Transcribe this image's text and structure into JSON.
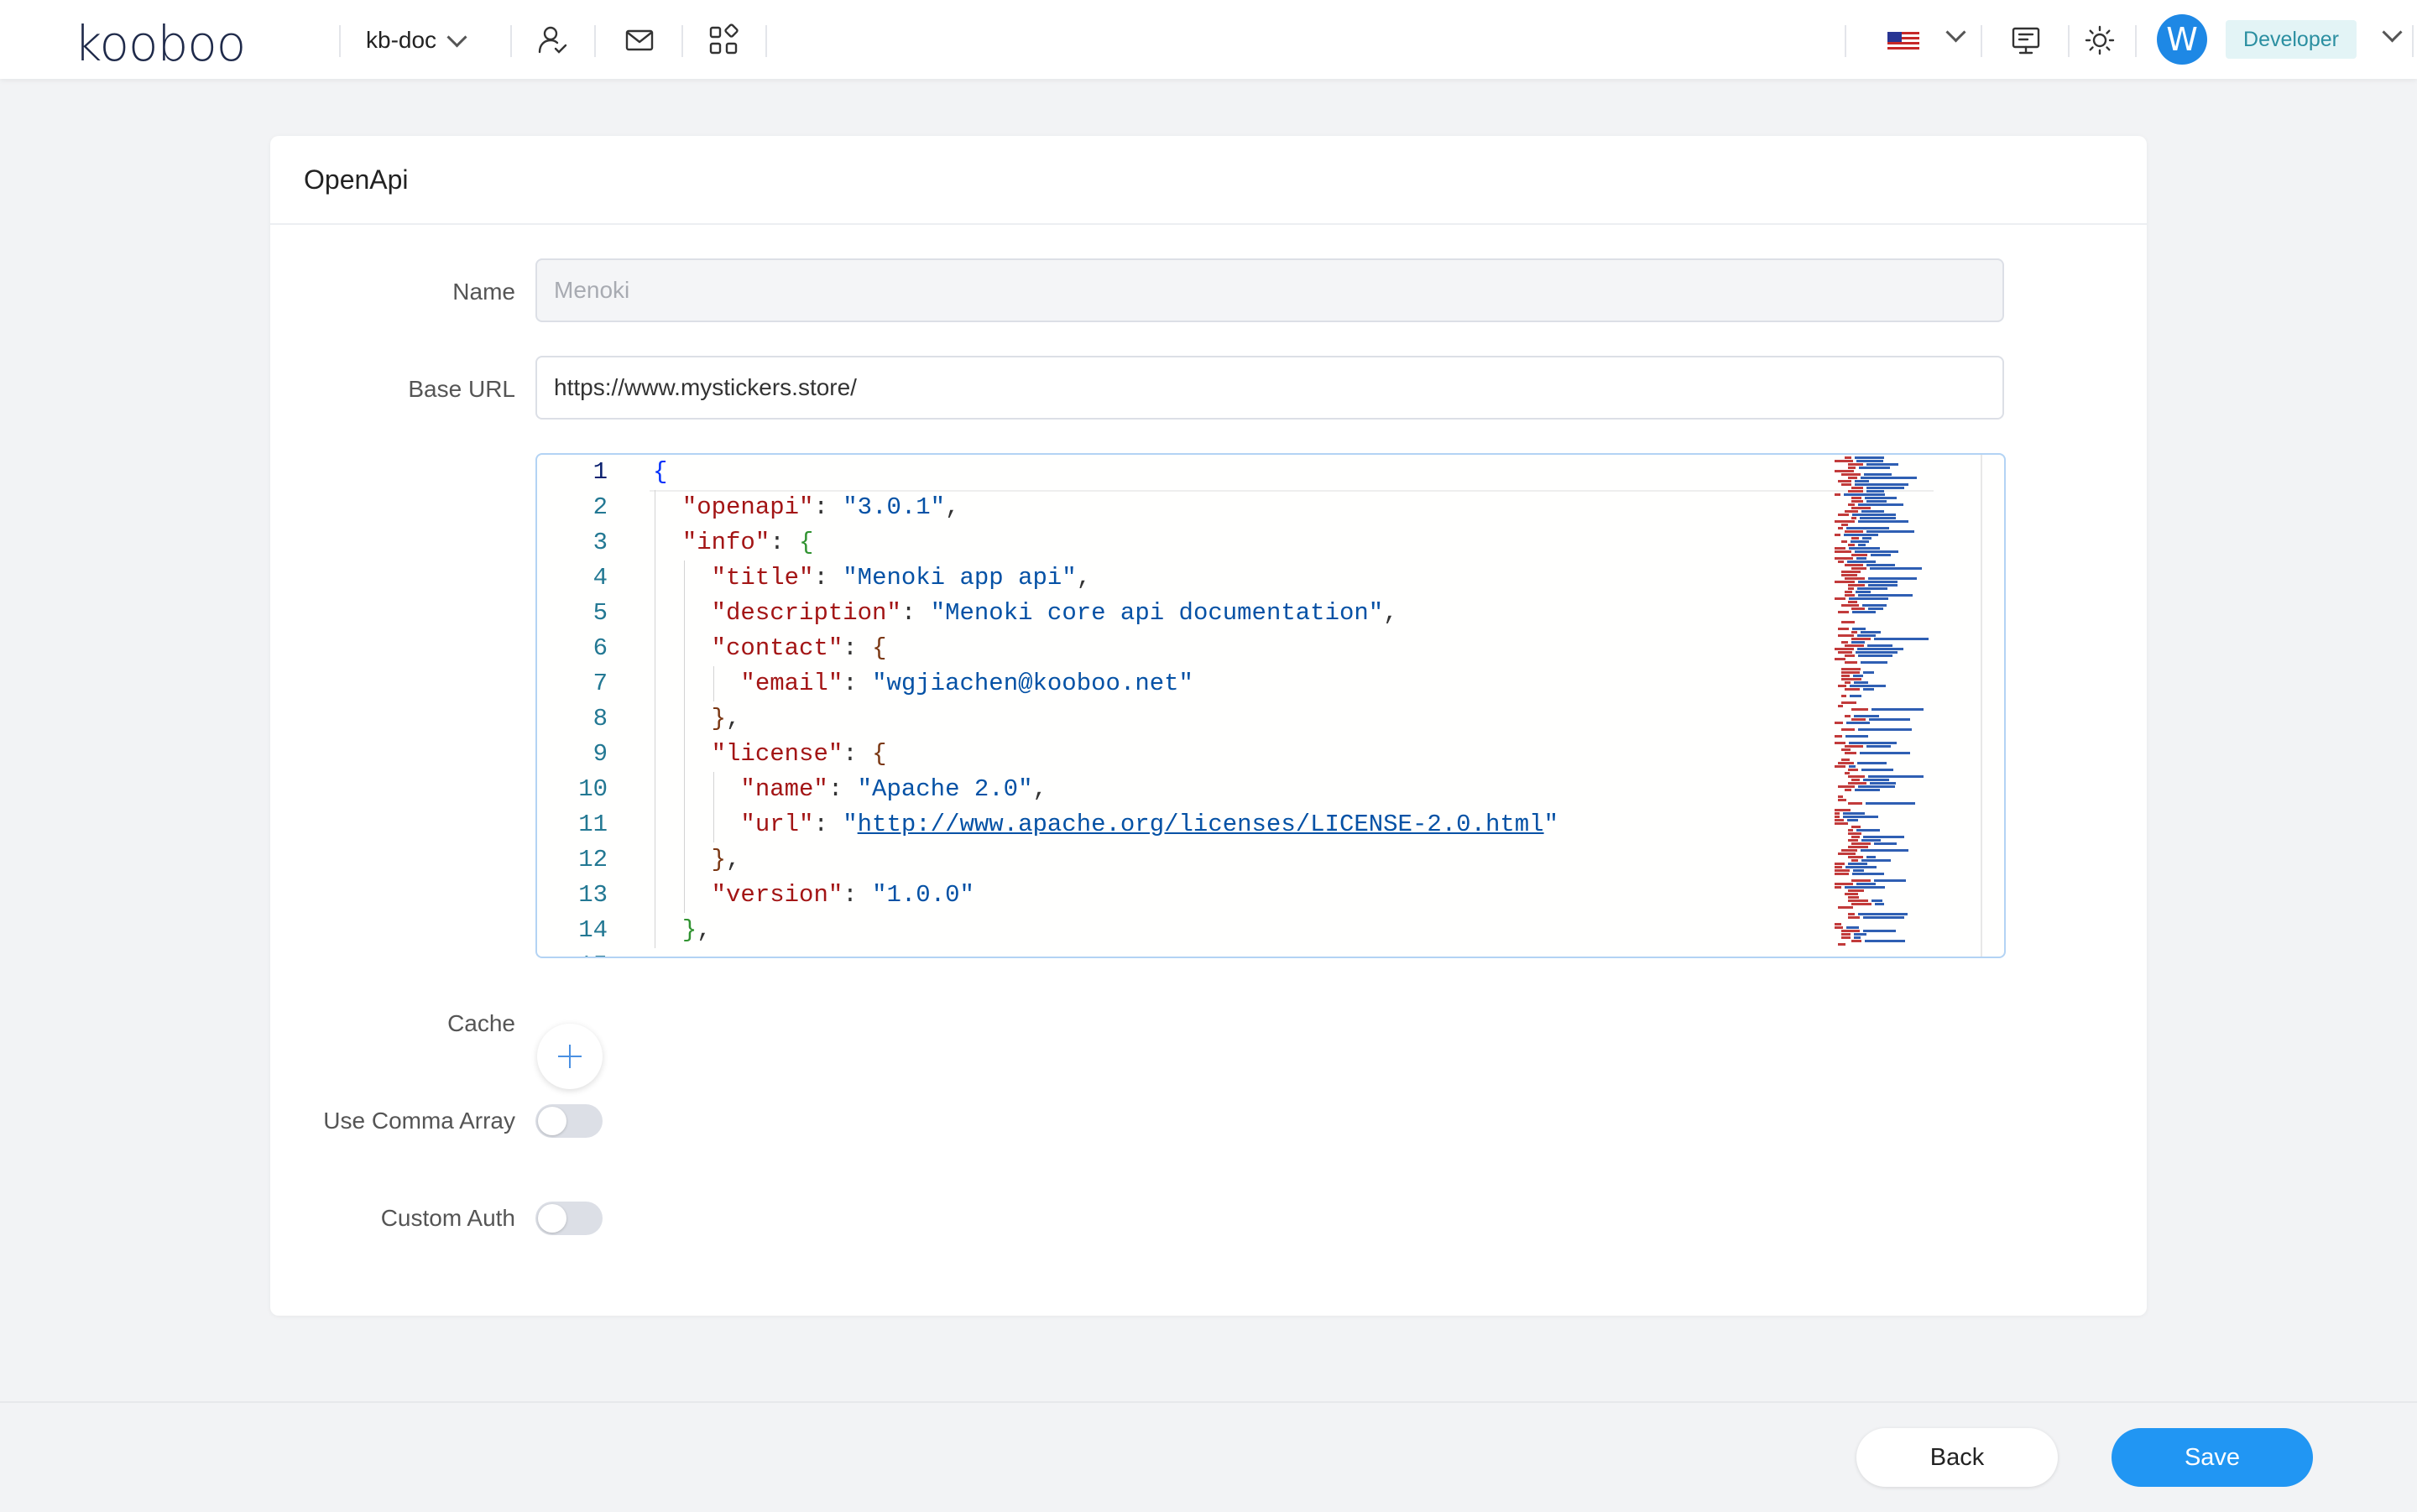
{
  "header": {
    "logo_text": "kooboo",
    "site_name": "kb-doc",
    "icons": [
      "user-switch-icon",
      "mail-icon",
      "apps-grid-icon",
      "us-flag-icon",
      "presentation-icon",
      "sun-icon"
    ],
    "avatar_letter": "W",
    "role": "Developer"
  },
  "card": {
    "title": "OpenApi",
    "name_label": "Name",
    "name_value": "Menoki",
    "base_url_label": "Base URL",
    "base_url_value": "https://www.mystickers.store/",
    "cache_label": "Cache",
    "use_comma_array_label": "Use Comma Array",
    "use_comma_array_on": false,
    "custom_auth_label": "Custom Auth",
    "custom_auth_on": false
  },
  "editor": {
    "lines": [
      {
        "n": "1",
        "code": "{"
      },
      {
        "n": "2",
        "code": "  \"openapi\": \"3.0.1\","
      },
      {
        "n": "3",
        "code": "  \"info\": {"
      },
      {
        "n": "4",
        "code": "    \"title\": \"Menoki app api\","
      },
      {
        "n": "5",
        "code": "    \"description\": \"Menoki core api documentation\","
      },
      {
        "n": "6",
        "code": "    \"contact\": {"
      },
      {
        "n": "7",
        "code": "      \"email\": \"wgjiachen@kooboo.net\""
      },
      {
        "n": "8",
        "code": "    },"
      },
      {
        "n": "9",
        "code": "    \"license\": {"
      },
      {
        "n": "10",
        "code": "      \"name\": \"Apache 2.0\","
      },
      {
        "n": "11",
        "code": "      \"url\": \"http://www.apache.org/licenses/LICENSE-2.0.html\""
      },
      {
        "n": "12",
        "code": "    },"
      },
      {
        "n": "13",
        "code": "    \"version\": \"1.0.0\""
      },
      {
        "n": "14",
        "code": "  },"
      }
    ]
  },
  "footer": {
    "back_label": "Back",
    "save_label": "Save"
  },
  "colors": {
    "primary": "#2196f3",
    "role_badge_bg": "#e3f4f6",
    "role_badge_text": "#2b8fa1",
    "json_key": "#a31515",
    "json_string": "#0451a5"
  }
}
